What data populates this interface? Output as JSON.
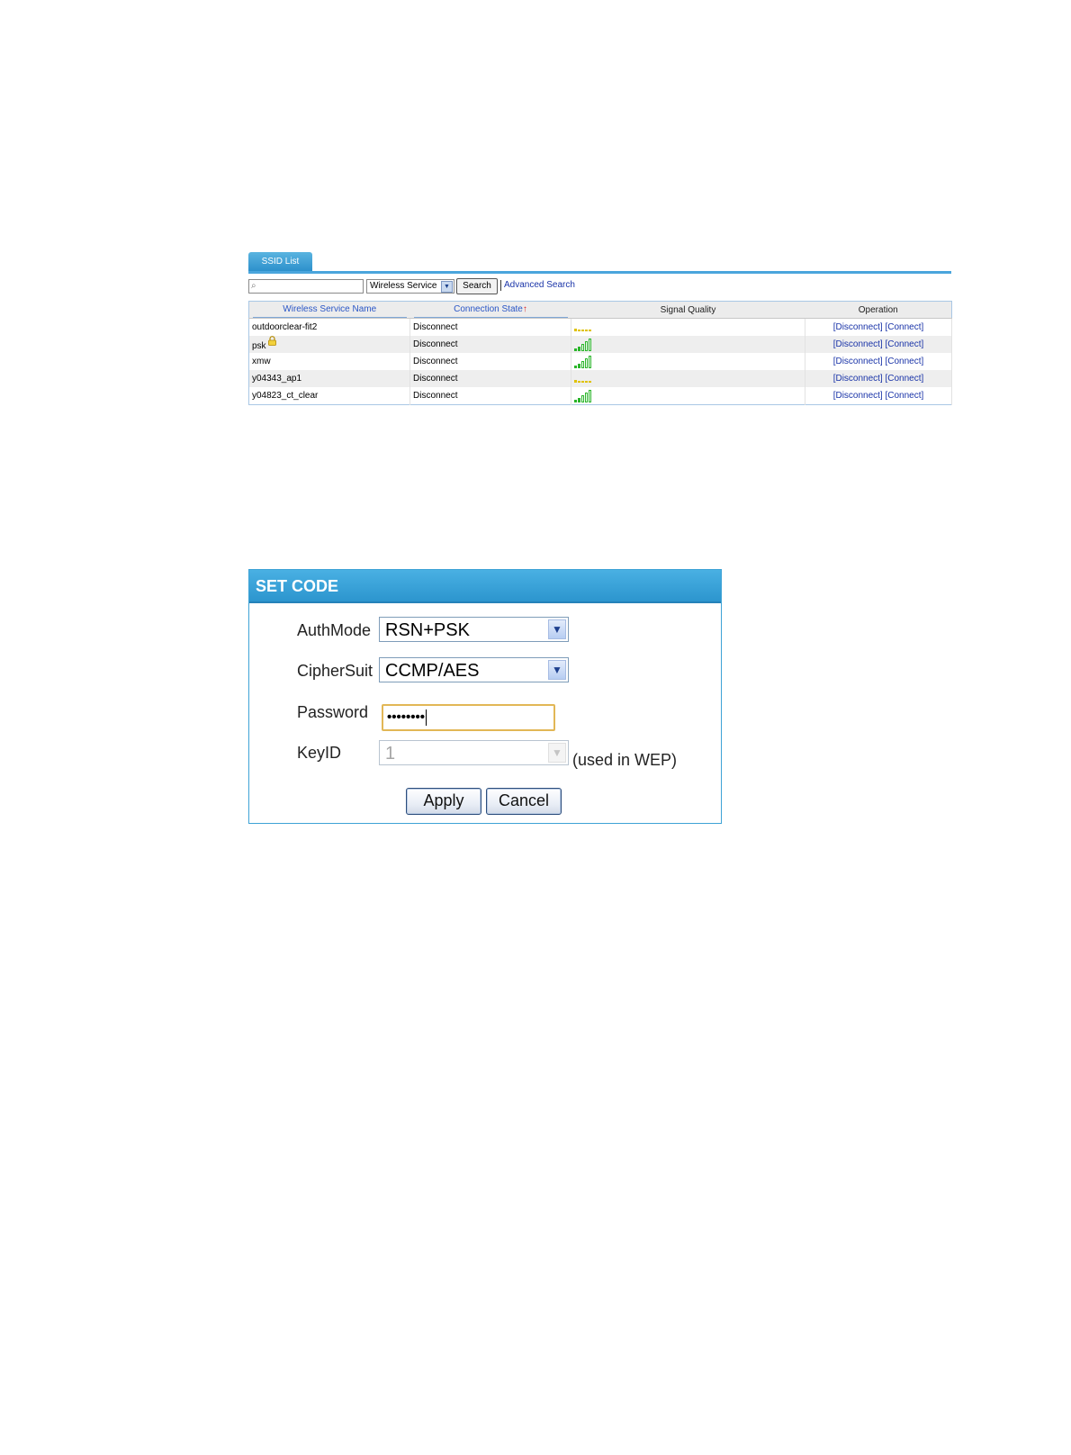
{
  "ssid_list": {
    "tab_label": "SSID List",
    "search_placeholder": "",
    "filter_select": "Wireless Service",
    "search_button": "Search",
    "advanced_search": "Advanced Search",
    "columns": [
      "Wireless Service Name",
      "Connection State",
      "Signal Quality",
      "Operation"
    ],
    "sort_indicator": "↑",
    "rows": [
      {
        "name": "outdoorclear-fit2",
        "locked": false,
        "state": "Disconnect",
        "signal_level": 1,
        "signal_color": "#e0c200",
        "disconnect": "[Disconnect]",
        "connect": "[Connect]"
      },
      {
        "name": "psk",
        "locked": true,
        "state": "Disconnect",
        "signal_level": 5,
        "signal_color": "#2ab52a",
        "disconnect": "[Disconnect]",
        "connect": "[Connect]"
      },
      {
        "name": "xmw",
        "locked": false,
        "state": "Disconnect",
        "signal_level": 5,
        "signal_color": "#2ab52a",
        "disconnect": "[Disconnect]",
        "connect": "[Connect]"
      },
      {
        "name": "y04343_ap1",
        "locked": false,
        "state": "Disconnect",
        "signal_level": 1,
        "signal_color": "#e0c200",
        "disconnect": "[Disconnect]",
        "connect": "[Connect]"
      },
      {
        "name": "y04823_ct_clear",
        "locked": false,
        "state": "Disconnect",
        "signal_level": 5,
        "signal_color": "#2ab52a",
        "disconnect": "[Disconnect]",
        "connect": "[Connect]"
      }
    ]
  },
  "set_code": {
    "title": "SET CODE",
    "authmode_label": "AuthMode",
    "authmode_value": "RSN+PSK",
    "ciphersuit_label": "CipherSuit",
    "ciphersuit_value": "CCMP/AES",
    "password_label": "Password",
    "password_mask": "••••••••",
    "keyid_label": "KeyID",
    "keyid_value": "1",
    "keyid_hint": "(used in WEP)",
    "apply_button": "Apply",
    "cancel_button": "Cancel"
  },
  "colors": {
    "accent": "#2c95ce",
    "link": "#1a34a8",
    "focus_border": "#e2b756"
  }
}
